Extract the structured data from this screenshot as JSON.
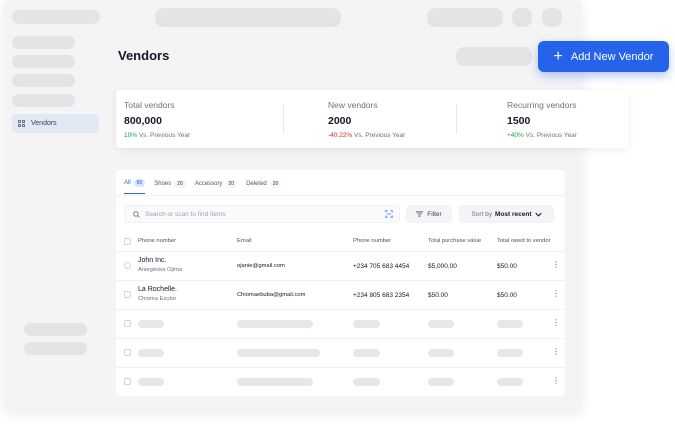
{
  "sidebar": {
    "active_item": {
      "label": "Vendors",
      "icon": "grid-icon"
    }
  },
  "page": {
    "title": "Vendors"
  },
  "actions": {
    "add_vendor_label": "Add New Vendor",
    "add_vendor_icon": "plus-icon",
    "accent": "#2563eb"
  },
  "stats": [
    {
      "label": "Total vendors",
      "value": "800,000",
      "change": "10%",
      "change_color": "#16a34a",
      "compare": "Vs. Previous Year"
    },
    {
      "label": "New vendors",
      "value": "2000",
      "change": "-40.22%",
      "change_color": "#dc2626",
      "compare": "Vs. Previous Year"
    },
    {
      "label": "Recurring vendors",
      "value": "1500",
      "change": "+40%",
      "change_color": "#16a34a",
      "compare": "Vs. Previous Year"
    }
  ],
  "tabs": [
    {
      "label": "All",
      "count": "80"
    },
    {
      "label": "Shoes",
      "count": "20"
    },
    {
      "label": "Accessory",
      "count": "20"
    },
    {
      "label": "Deleted",
      "count": "20"
    }
  ],
  "search": {
    "placeholder": "Search or scan to find items"
  },
  "filter": {
    "label": "Filter"
  },
  "sort": {
    "label": "Sort by",
    "value": "Most recent"
  },
  "table": {
    "columns": [
      "Phone number",
      "Email",
      "Phone number",
      "Total purchase value",
      "Total owed to vendor"
    ],
    "rows": [
      {
        "name": "John Inc.",
        "contact": "Aniegéoka Ojima",
        "email": "ojanie@gmail.com",
        "phone": "+234 705 683 4454",
        "purchase": "$5,000.00",
        "owed": "$50.00"
      },
      {
        "name": "La Rochelle.",
        "contact": "Chioma Ezubo",
        "email": "Chiomaebuba@gmail.com",
        "phone": "+234 805 683 2354",
        "purchase": "$50.00",
        "owed": "$50.00"
      }
    ]
  }
}
